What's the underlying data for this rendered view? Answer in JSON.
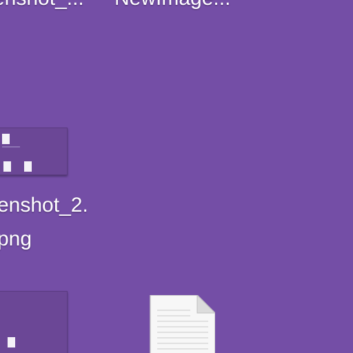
{
  "desktop": {
    "background": "#744ea6",
    "icons": [
      {
        "label": "enshot_...",
        "kind": "image-file"
      },
      {
        "label": "NewImage...",
        "kind": "image-file"
      },
      {
        "label_line1": "enshot_2.",
        "label_line2": "png",
        "kind": "image-file"
      },
      {
        "kind": "image-file"
      },
      {
        "kind": "text-document",
        "icon": "blank-document-icon"
      }
    ]
  }
}
